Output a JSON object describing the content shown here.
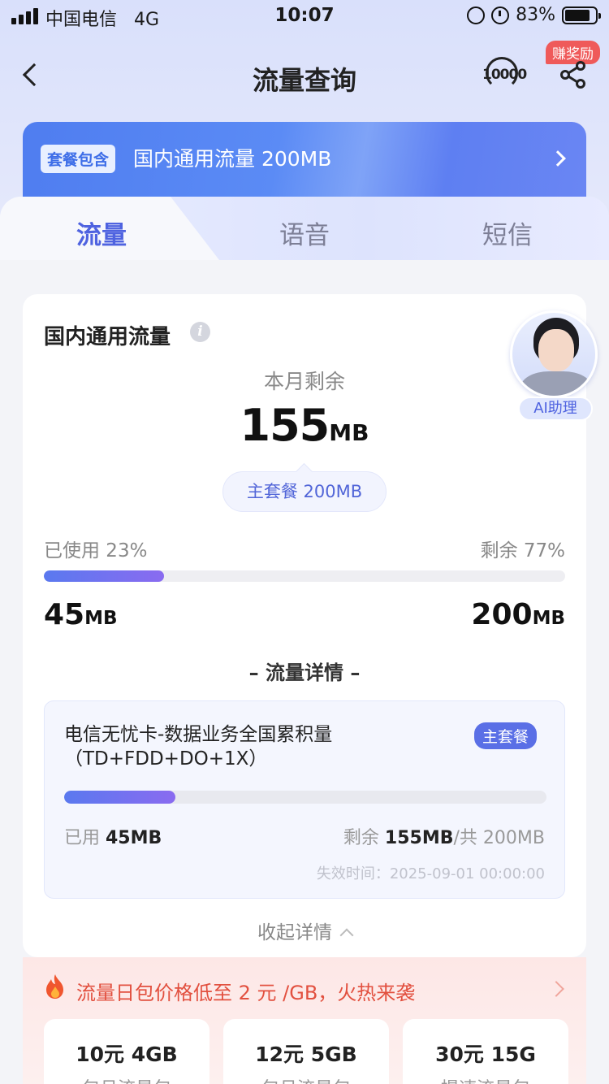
{
  "status_bar": {
    "carrier": "中国电信",
    "network": "4G",
    "time": "10:07",
    "battery": "83%"
  },
  "nav": {
    "title": "流量查询",
    "hotline_number": "10000",
    "reward_badge": "赚奖励"
  },
  "banner": {
    "tag": "套餐包含",
    "text": "国内通用流量 200MB"
  },
  "tabs": [
    {
      "label": "流量",
      "active": true
    },
    {
      "label": "语音",
      "active": false
    },
    {
      "label": "短信",
      "active": false
    }
  ],
  "usage_card": {
    "title": "国内通用流量",
    "remain_label": "本月剩余",
    "remain_value": "155",
    "remain_unit": "MB",
    "plan_pill": "主套餐 200MB",
    "used_percent_label": "已使用 23%",
    "remain_percent_label": "剩余 77%",
    "used_fraction": 0.23,
    "used_amount": "45",
    "used_unit": "MB",
    "total_amount": "200",
    "total_unit": "MB",
    "details_heading": "– 流量详情 –",
    "collapse_label": "收起详情"
  },
  "detail_item": {
    "name_line1": "电信无忧卡-数据业务全国累积量",
    "name_line2": "（TD+FDD+DO+1X）",
    "badge": "主套餐",
    "used_prefix": "已用 ",
    "used_value": "45MB",
    "remain_prefix": "剩余 ",
    "remain_value": "155MB",
    "total_text": "/共 200MB",
    "expire": "失效时间：2025-09-01 00:00:00",
    "used_fraction": 0.23
  },
  "ai_assistant": {
    "label": "AI助理"
  },
  "promo": {
    "text": "流量日包价格低至 2 元 /GB，火热来袭",
    "packs": [
      {
        "title": "10元 4GB",
        "subtitle": "包月流量包"
      },
      {
        "title": "12元 5GB",
        "subtitle": "包月流量包"
      },
      {
        "title": "30元 15G",
        "subtitle": "提速流量包"
      }
    ]
  }
}
